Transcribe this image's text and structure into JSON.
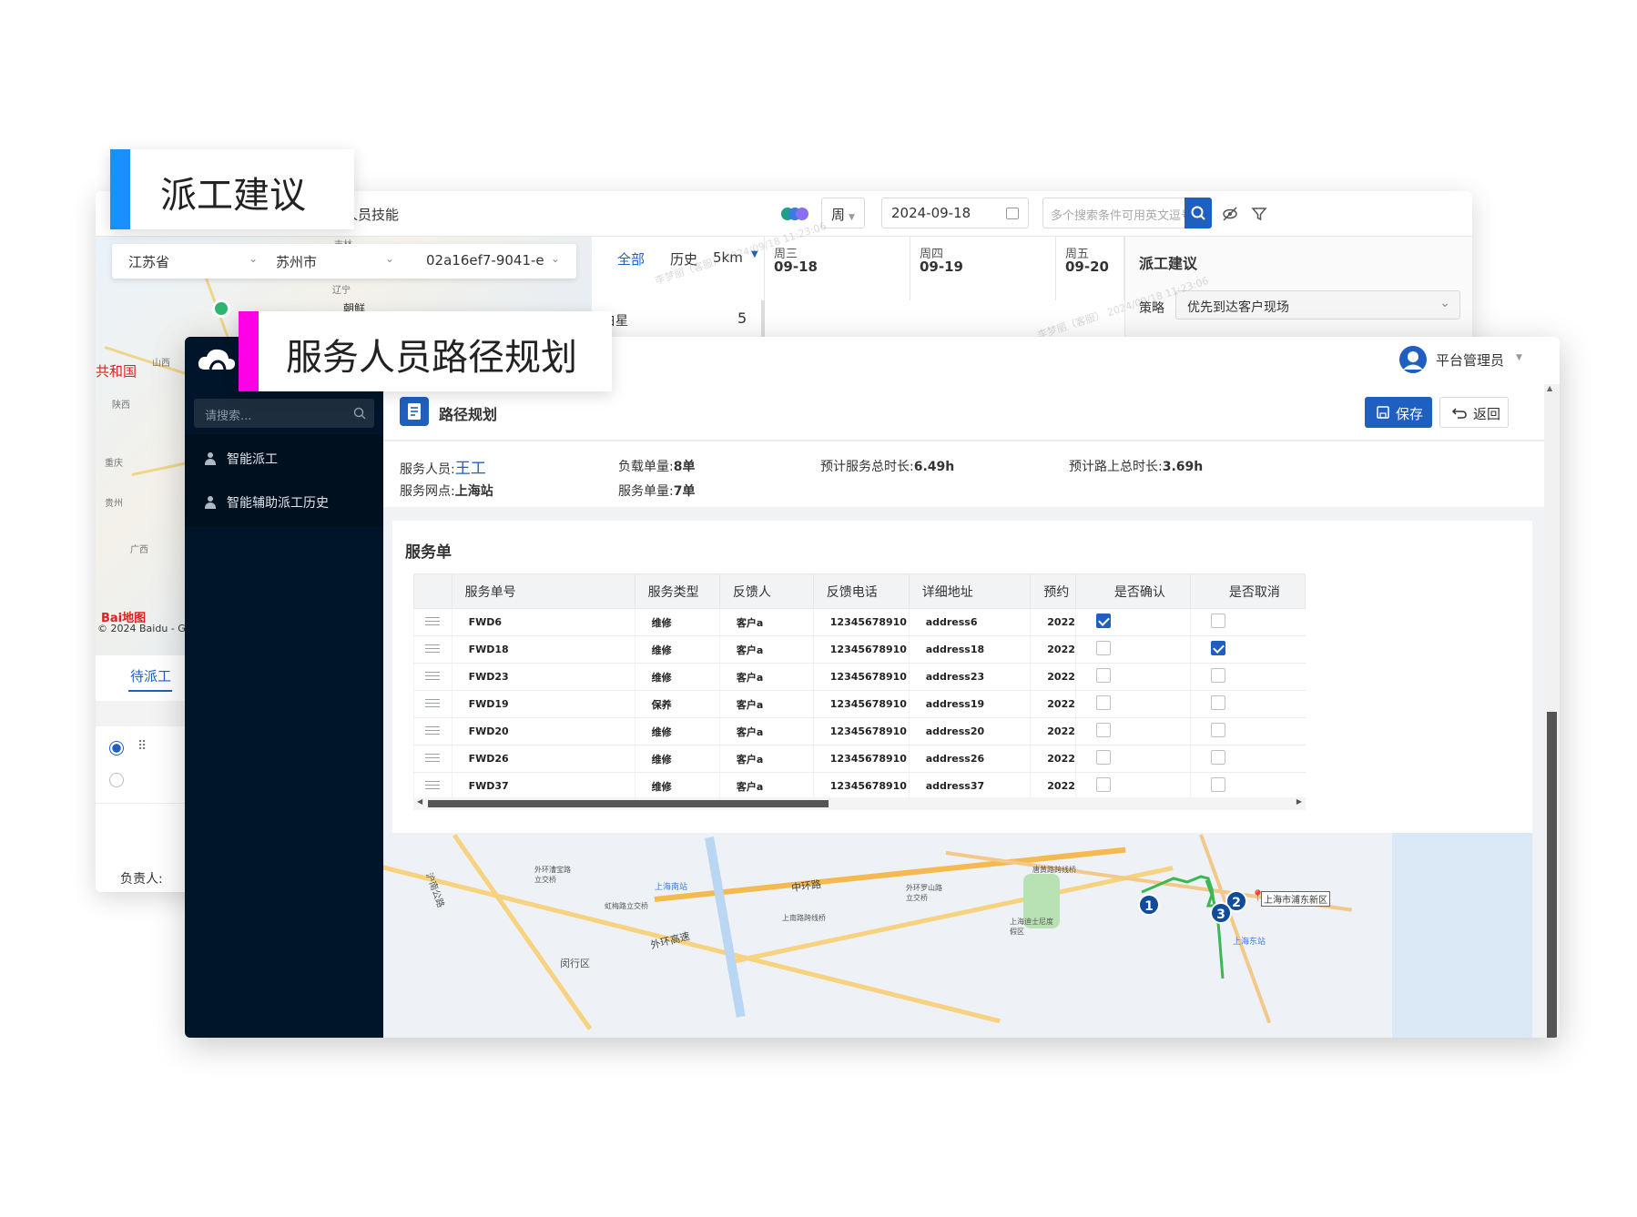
{
  "tags": {
    "dispatch_suggestion": "派工建议",
    "route_planning": "服务人员路径规划"
  },
  "back_window": {
    "skill_checkbox_label": "人员技能",
    "period_select": "周",
    "date_value": "2024-09-18",
    "search_placeholder": "多个搜索条件可用英文逗号",
    "province": "江苏省",
    "city": "苏州市",
    "record_id": "02a16ef7-9041-e",
    "filter_tabs": {
      "all": "全部",
      "history": "历史",
      "distance": "5km"
    },
    "day_columns": [
      {
        "weekday": "周三",
        "date": "09-18"
      },
      {
        "weekday": "周四",
        "date": "09-19"
      },
      {
        "weekday": "周五",
        "date": "09-20"
      }
    ],
    "group_row": {
      "label": "白星",
      "count": "5"
    },
    "suggest_panel": {
      "title": "派工建议",
      "strategy_label": "策略",
      "strategy_value": "优先到达客户现场"
    },
    "pending_tab": "待派工",
    "owner_label": "负责人:",
    "map_labels": {
      "korea": "朝鲜",
      "china": "共和国",
      "copyright": "© 2024 Baidu - G",
      "baidu_logo": "Bai地图",
      "jilin": "吉林",
      "liaoning": "辽宁",
      "shaanxi": "陕西",
      "chongqing": "重庆",
      "guizhou": "贵州",
      "guangxi": "广西",
      "shanxi": "山西"
    },
    "watermark": "李梦丽（客服） 2024/09/18 11:23:06"
  },
  "front_window": {
    "user_name": "平台管理员",
    "sidebar": {
      "search_placeholder": "请搜索...",
      "items": [
        {
          "label": "智能派工"
        },
        {
          "label": "智能辅助派工历史"
        }
      ]
    },
    "page_title": "路径规划",
    "save_label": "保存",
    "back_label": "返回",
    "info": {
      "person_label": "服务人员:",
      "person_value": "王工",
      "load_label": "负载单量:",
      "load_value": "8单",
      "service_time_label": "预计服务总时长:",
      "service_time_value": "6.49h",
      "road_time_label": "预计路上总时长:",
      "road_time_value": "3.69h",
      "site_label": "服务网点:",
      "site_value": "上海站",
      "orders_label": "服务单量:",
      "orders_value": "7单"
    },
    "orders_title": "服务单",
    "columns": [
      "服务单号",
      "服务类型",
      "反馈人",
      "反馈电话",
      "详细地址",
      "预约",
      "是否确认",
      "是否取消"
    ],
    "rows": [
      {
        "id": "FWD6",
        "type": "维修",
        "person": "客户a",
        "phone": "12345678910",
        "address": "address6",
        "date": "2022",
        "confirmed": true,
        "cancelled": false
      },
      {
        "id": "FWD18",
        "type": "维修",
        "person": "客户a",
        "phone": "12345678910",
        "address": "address18",
        "date": "2022",
        "confirmed": false,
        "cancelled": true
      },
      {
        "id": "FWD23",
        "type": "维修",
        "person": "客户a",
        "phone": "12345678910",
        "address": "address23",
        "date": "2022",
        "confirmed": false,
        "cancelled": false
      },
      {
        "id": "FWD19",
        "type": "保养",
        "person": "客户a",
        "phone": "12345678910",
        "address": "address19",
        "date": "2022",
        "confirmed": false,
        "cancelled": false
      },
      {
        "id": "FWD20",
        "type": "维修",
        "person": "客户a",
        "phone": "12345678910",
        "address": "address20",
        "date": "2022",
        "confirmed": false,
        "cancelled": false
      },
      {
        "id": "FWD26",
        "type": "维修",
        "person": "客户a",
        "phone": "12345678910",
        "address": "address26",
        "date": "2022",
        "confirmed": false,
        "cancelled": false
      },
      {
        "id": "FWD37",
        "type": "维修",
        "person": "客户a",
        "phone": "12345678910",
        "address": "address37",
        "date": "2022",
        "confirmed": false,
        "cancelled": false
      }
    ],
    "map_labels": {
      "middle_ring": "中环路",
      "outer_ring": "外环高速",
      "shanghai_south": "上海南站",
      "shanghai_east": "上海东站",
      "pudong": "上海市浦东新区",
      "disney": "上海迪士尼度假区",
      "minhang": "闵行区",
      "hongmei": "虹梅路立交桥",
      "waihuan_caojing": "外环漕宝路立交桥",
      "waihuan_luoshan": "外环罗山路立交桥",
      "shangnan": "上南路跨线桥",
      "tangzhen": "唐黄路跨线桥",
      "huanhu_highway": "沪南公路"
    },
    "route_points": [
      "1",
      "2",
      "3"
    ]
  },
  "colors": {
    "primary": "#1f5fbf",
    "sidebar": "#001529",
    "tag_blue": "#1890ff",
    "tag_magenta": "#ff00e6",
    "route_green": "#3cb850"
  }
}
